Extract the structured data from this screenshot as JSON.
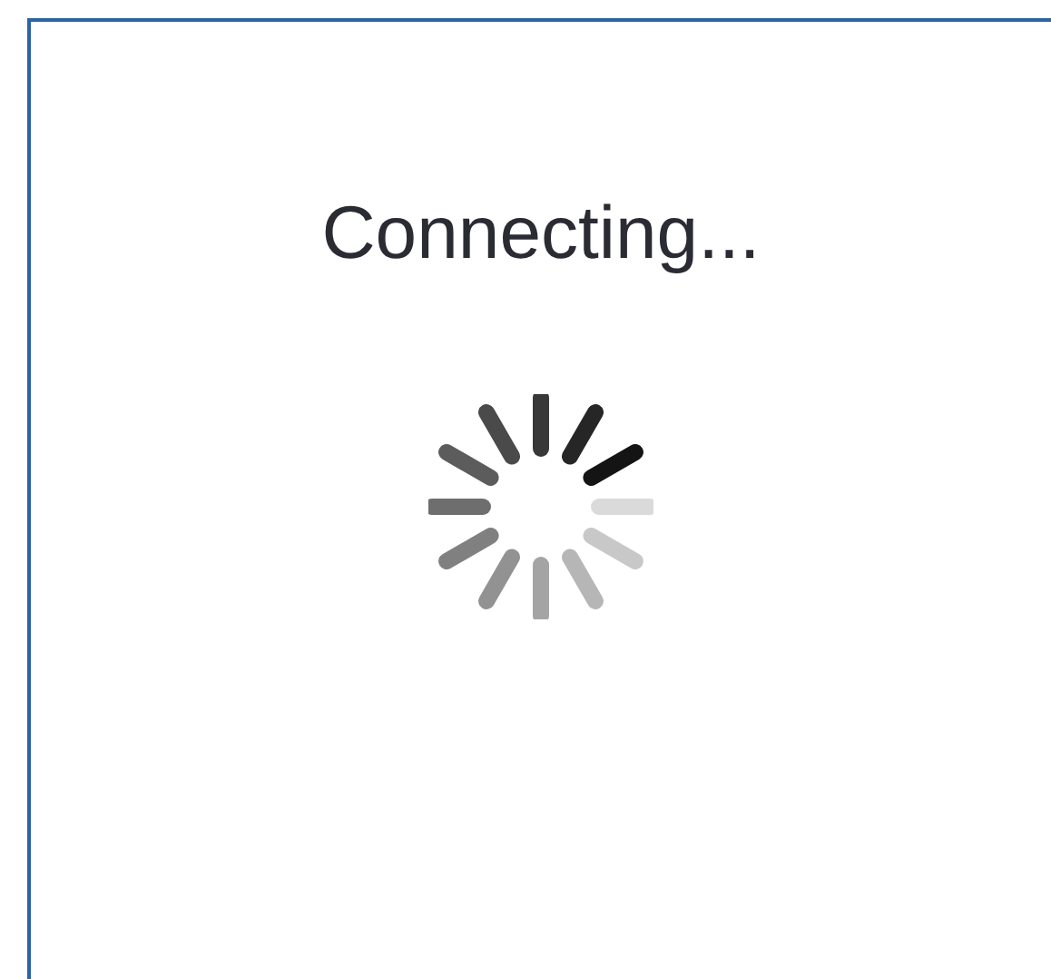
{
  "dialog": {
    "message": "Connecting..."
  }
}
